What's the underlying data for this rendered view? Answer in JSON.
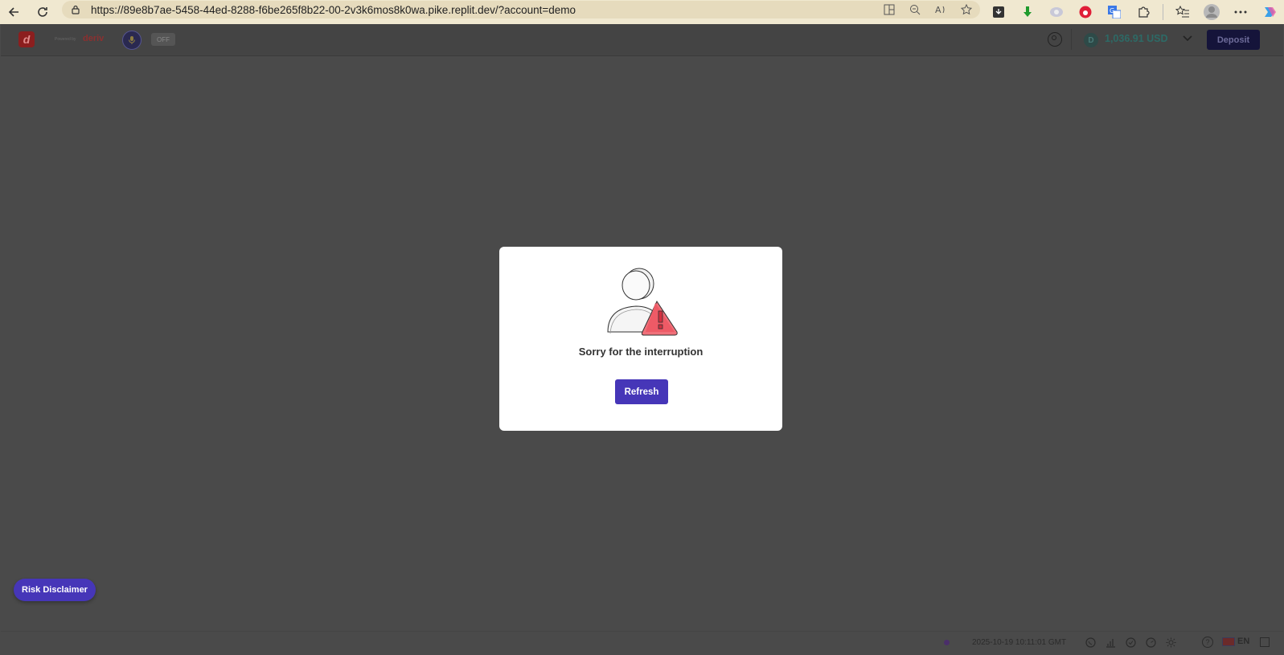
{
  "browser": {
    "url": "https://89e8b7ae-5458-44ed-8288-f6be265f8b22-00-2v3k6mos8k0wa.pike.replit.dev/?account=demo",
    "address_icons": [
      "split-screen-icon",
      "zoom-out-icon",
      "read-aloud-icon",
      "favorite-star-icon"
    ],
    "extension_icons": [
      "download-ext-icon",
      "green-arrow-ext-icon",
      "chat-ext-icon",
      "vodafone-ext-icon",
      "translate-ext-icon",
      "extensions-puzzle-icon",
      "favorites-icon",
      "profile-icon",
      "more-menu-icon",
      "copilot-icon"
    ]
  },
  "header": {
    "powered_by": "Powered by",
    "brand": "deriv",
    "toggle_label": "OFF",
    "balance": "1,036.91 USD",
    "deposit_label": "Deposit"
  },
  "dialog": {
    "message": "Sorry for the interruption",
    "refresh_label": "Refresh"
  },
  "risk_disclaimer_label": "Risk Disclaimer",
  "footer": {
    "timestamp": "2025-10-19 10:11:01 GMT",
    "language": "EN"
  },
  "colors": {
    "primary_button": "#4636b8",
    "overlay": "#4a4a4a",
    "browser_chrome": "#f0e8d0",
    "balance_text": "#2d6a66"
  }
}
